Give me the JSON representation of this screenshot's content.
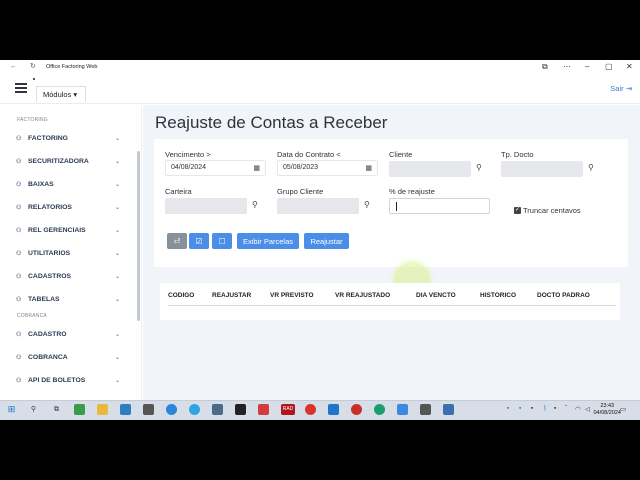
{
  "window": {
    "title": "Office Factoring Web"
  },
  "topbar": {
    "modules_label": "Módulos ▾",
    "logout_label": "Sair"
  },
  "sidebar": {
    "section_factoring": "FACTORING",
    "factoring_items": [
      {
        "label": "FACTORING",
        "icon": "users-icon"
      },
      {
        "label": "SECURITIZADORA",
        "icon": "users-icon"
      },
      {
        "label": "BAIXAS",
        "icon": "users-icon"
      },
      {
        "label": "RELATORIOS",
        "icon": "users-icon"
      },
      {
        "label": "REL GERENCIAIS",
        "icon": "users-icon"
      },
      {
        "label": "UTILITARIOS",
        "icon": "users-icon"
      },
      {
        "label": "CADASTROS",
        "icon": "users-icon"
      },
      {
        "label": "TABELAS",
        "icon": "users-icon"
      }
    ],
    "section_cobranca": "COBRANCA",
    "cobranca_items": [
      {
        "label": "CADASTRO",
        "icon": "users-icon"
      },
      {
        "label": "COBRANCA",
        "icon": "users-icon"
      },
      {
        "label": "API DE BOLETOS",
        "icon": "users-icon"
      }
    ]
  },
  "page": {
    "title": "Reajuste de Contas a Receber"
  },
  "filters": {
    "vencimento_label": "Vencimento >",
    "vencimento_value": "04/08/2024",
    "data_contrato_label": "Data do Contrato <",
    "data_contrato_value": "05/08/2023",
    "cliente_label": "Cliente",
    "cliente_value": "",
    "tp_docto_label": "Tp. Docto",
    "tp_docto_value": "",
    "carteira_label": "Carteira",
    "carteira_value": "",
    "grupo_cliente_label": "Grupo Cliente",
    "grupo_cliente_value": "",
    "pct_reajuste_label": "% de reajuste",
    "pct_reajuste_value": "",
    "truncar_label": "Truncar centavos",
    "truncar_checked": true
  },
  "actions": {
    "exibir_label": "Exibir Parcelas",
    "reajustar_label": "Reajustar"
  },
  "table": {
    "columns": [
      "CODIGO",
      "REAJUSTAR",
      "VR PREVISTO",
      "VR REAJUSTADO",
      "DIA VENCTO",
      "HISTORICO",
      "DOCTO PADRAO"
    ]
  },
  "taskbar": {
    "time": "23:43",
    "date": "04/08/2024",
    "rad_label": "RAD"
  },
  "colors": {
    "primary": "#4b8ee8",
    "secondary": "#8a9098",
    "page_bg": "#f1f4f8"
  }
}
